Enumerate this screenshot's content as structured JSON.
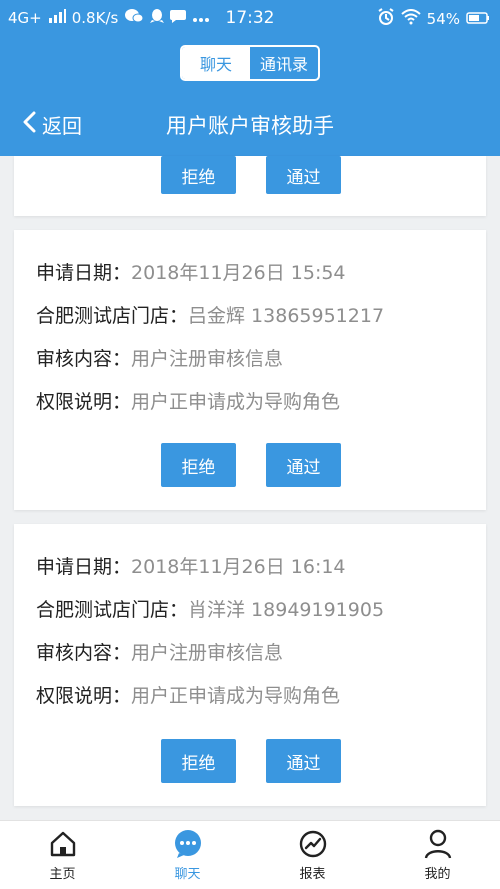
{
  "status_bar": {
    "network": "4G+",
    "speed": "0.8K/s",
    "time": "17:32",
    "battery": "54%"
  },
  "segment": {
    "left_label": "聊天",
    "right_label": "通讯录"
  },
  "nav": {
    "back_label": "返回",
    "title": "用户账户审核助手"
  },
  "labels": {
    "date": "申请日期：",
    "store": "合肥测试店门店：",
    "content": "审核内容：",
    "permission": "权限说明："
  },
  "buttons": {
    "reject": "拒绝",
    "approve": "通过"
  },
  "requests": [
    {
      "date": "2018年11月26日 15:54",
      "store_value": "吕金辉 13865951217",
      "content": "用户注册审核信息",
      "permission": "用户正申请成为导购角色"
    },
    {
      "date": "2018年11月26日 16:14",
      "store_value": "肖洋洋 18949191905",
      "content": "用户注册审核信息",
      "permission": "用户正申请成为导购角色"
    }
  ],
  "tabs": [
    {
      "label": "主页",
      "icon": "home-icon"
    },
    {
      "label": "聊天",
      "icon": "chat-icon"
    },
    {
      "label": "报表",
      "icon": "report-icon"
    },
    {
      "label": "我的",
      "icon": "profile-icon"
    }
  ],
  "colors": {
    "primary": "#3a97e0",
    "background": "#eef0f2",
    "value_text": "#8e8e8e"
  }
}
